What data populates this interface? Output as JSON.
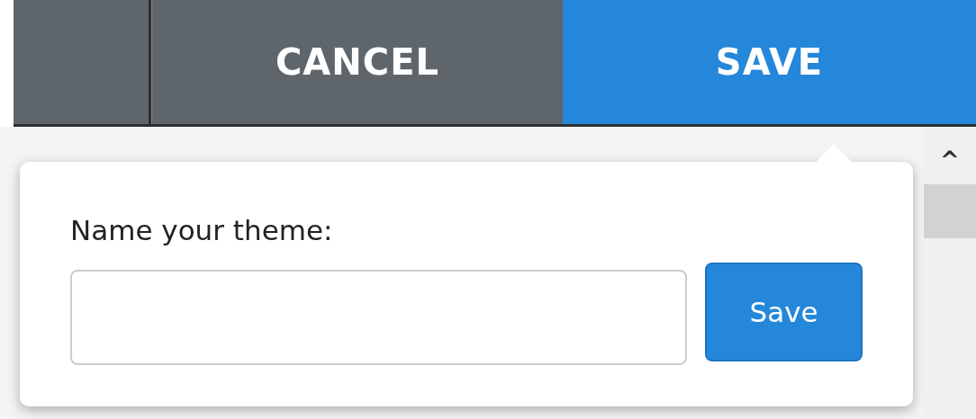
{
  "toolbar": {
    "buttons": [
      {
        "label": "CANCEL",
        "kind": "cancel"
      },
      {
        "label": "SAVE",
        "kind": "save"
      }
    ]
  },
  "scrollbar": {
    "up_arrow": "^"
  },
  "popover": {
    "label": "Name your theme:",
    "button": "Save"
  }
}
